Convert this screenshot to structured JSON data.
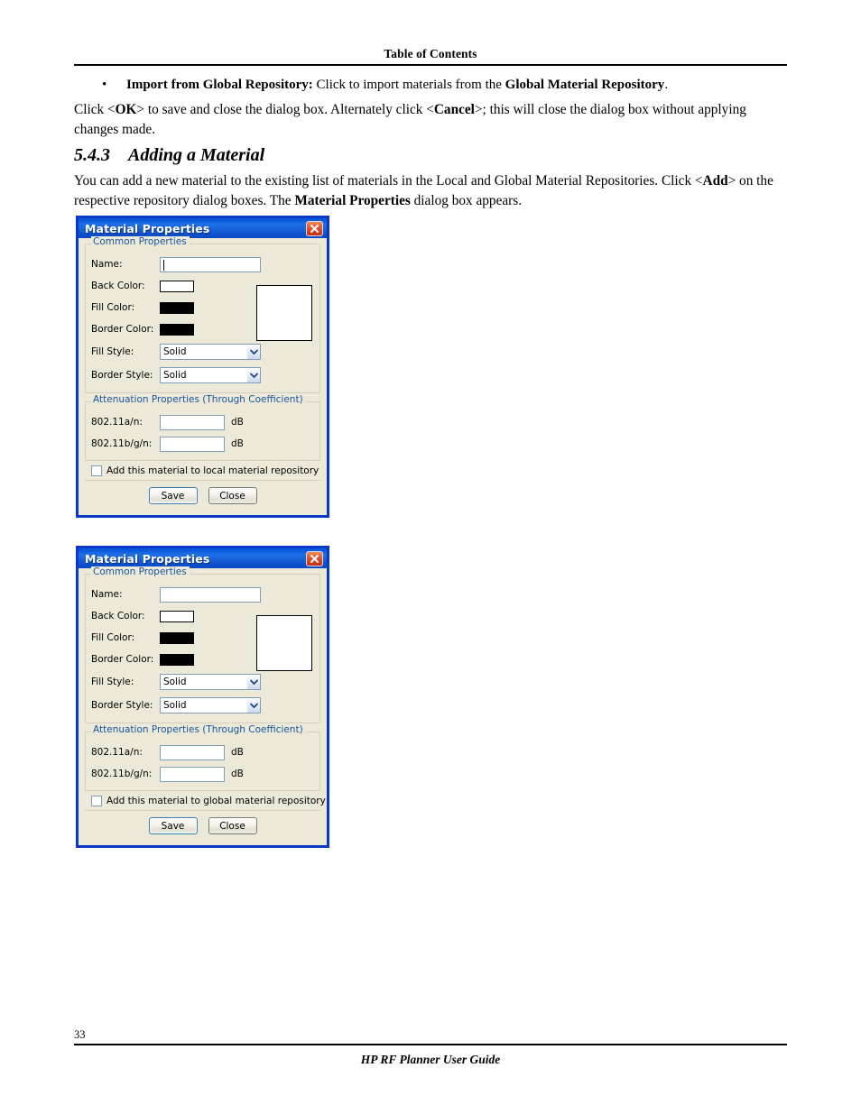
{
  "header": {
    "title": "Table of Contents"
  },
  "content": {
    "bullet": {
      "marker": "•",
      "term": "Import from Global Repository:",
      "rest_1": " Click to import materials from the ",
      "term_2": "Global Material Repository",
      "rest_2": "."
    },
    "paragraph_1": {
      "part_1": "Click <",
      "bold_1": "OK",
      "part_2": "> to save and close the dialog box. Alternately click <",
      "bold_2": "Cancel",
      "part_3": ">; this will close the dialog box without applying changes made."
    },
    "heading": {
      "number": "5.4.3",
      "text": "Adding a Material"
    },
    "paragraph_2": {
      "part_1": "You can add a new material to the existing list of materials in the Local and Global Material Repositories. Click <",
      "bold_1": "Add",
      "part_2": "> on the respective repository dialog boxes. The ",
      "bold_2": "Material Properties",
      "part_3": " dialog box appears."
    }
  },
  "dialog_local": {
    "title": "Material Properties",
    "close_label": "Close window",
    "common_group_legend": "Common Properties",
    "fields": {
      "name_label": "Name:",
      "name_value": "",
      "back_color_label": "Back Color:",
      "back_color_value": "#FFFFFF",
      "fill_color_label": "Fill Color:",
      "fill_color_value": "#000000",
      "border_color_label": "Border Color:",
      "border_color_value": "#000000",
      "fill_style_label": "Fill Style:",
      "fill_style_value": "Solid",
      "border_style_label": "Border Style:",
      "border_style_value": "Solid",
      "preview_color": "#FFFFFF"
    },
    "attenuation_group_legend": "Attenuation Properties (Through Coefficient)",
    "attenuation": {
      "a_n_label": "802.11a/n:",
      "a_n_value": "",
      "a_n_unit": "dB",
      "b_g_n_label": "802.11b/g/n:",
      "b_g_n_value": "",
      "b_g_n_unit": "dB"
    },
    "checkbox_label": "Add this material to local material repository",
    "checkbox_checked": false,
    "save_label": "Save",
    "close_button_label": "Close"
  },
  "dialog_global": {
    "title": "Material Properties",
    "close_label": "Close window",
    "common_group_legend": "Common Properties",
    "fields": {
      "name_label": "Name:",
      "name_value": "",
      "back_color_label": "Back Color:",
      "back_color_value": "#FFFFFF",
      "fill_color_label": "Fill Color:",
      "fill_color_value": "#000000",
      "border_color_label": "Border Color:",
      "border_color_value": "#000000",
      "fill_style_label": "Fill Style:",
      "fill_style_value": "Solid",
      "border_style_label": "Border Style:",
      "border_style_value": "Solid",
      "preview_color": "#FFFFFF"
    },
    "attenuation_group_legend": "Attenuation Properties (Through Coefficient)",
    "attenuation": {
      "a_n_label": "802.11a/n:",
      "a_n_value": "",
      "a_n_unit": "dB",
      "b_g_n_label": "802.11b/g/n:",
      "b_g_n_value": "",
      "b_g_n_unit": "dB"
    },
    "checkbox_label": "Add this material to global material repository",
    "checkbox_checked": false,
    "save_label": "Save",
    "close_button_label": "Close"
  },
  "footer": {
    "page_number": "33",
    "guide_title": "HP RF Planner User Guide"
  },
  "colors": {
    "titlebar_blue": "#1862D8",
    "dialog_face": "#ECE9D8",
    "group_legend_blue": "#17559C",
    "close_red": "#C62D10",
    "input_border": "#7F9DB9"
  }
}
